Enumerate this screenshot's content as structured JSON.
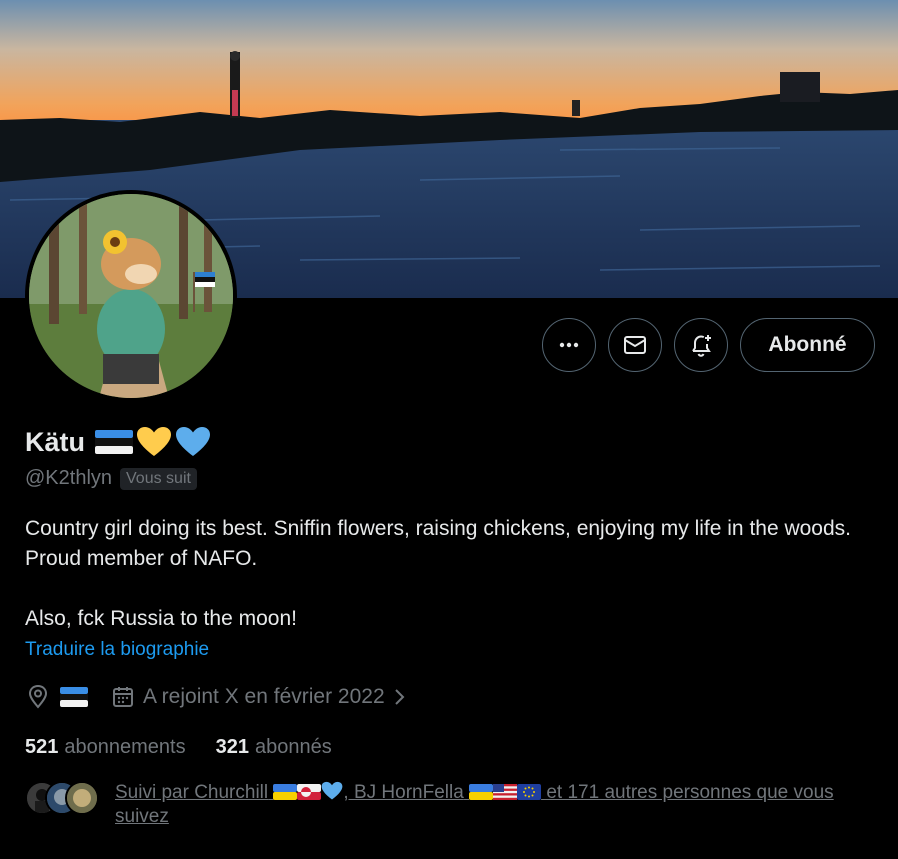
{
  "profile": {
    "display_name": "Kätu",
    "handle": "@K2thlyn",
    "follows_you_badge": "Vous suit",
    "bio": "Country girl doing its best. Sniffin flowers, raising chickens, enjoying my life in the woods. Proud member of NAFO.\n\nAlso, fck Russia to the moon!",
    "translate_link": "Traduire la biographie",
    "joined": "A rejoint X en février 2022",
    "name_emojis": [
      "estonia-flag",
      "yellow-heart",
      "blue-heart"
    ]
  },
  "actions": {
    "more_icon": "more-horizontal-icon",
    "message_icon": "mail-icon",
    "notify_icon": "bell-plus-icon",
    "follow_label": "Abonné"
  },
  "stats": {
    "following_count": "521",
    "following_label": "abonnements",
    "followers_count": "321",
    "followers_label": "abonnés"
  },
  "followed_by": {
    "prefix": "Suivi par Churchill",
    "second": ", BJ HornFella",
    "suffix": " et 171 autres personnes que vous suivez"
  },
  "colors": {
    "background": "#000000",
    "text": "#e7e9ea",
    "muted": "#71767b",
    "link": "#1d9bf0",
    "border": "#536471"
  }
}
